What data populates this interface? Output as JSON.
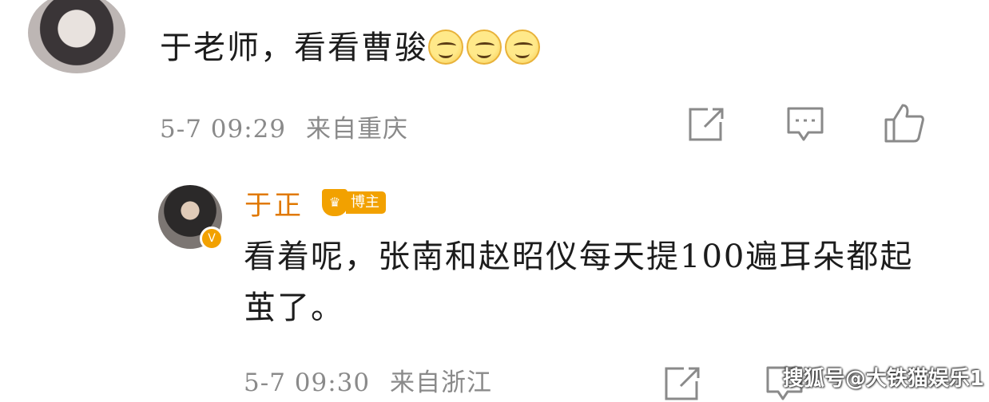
{
  "comment": {
    "text": "于老师，看看曹骏",
    "emoji_icons": [
      "smile-emoji",
      "smile-emoji",
      "smile-emoji"
    ],
    "time": "5-7 09:29",
    "location": "来自重庆"
  },
  "reply": {
    "author": "于正",
    "badge": "博主",
    "text": "看着呢，张南和赵昭仪每天提100遍耳朵都起茧了。",
    "time": "5-7 09:30",
    "location": "来自浙江"
  },
  "watermark": "搜狐号@大铁猫娱乐1",
  "colors": {
    "accent_name": "#e07800",
    "badge_bg": "#f2a100",
    "meta_text": "#8a8a8a"
  }
}
